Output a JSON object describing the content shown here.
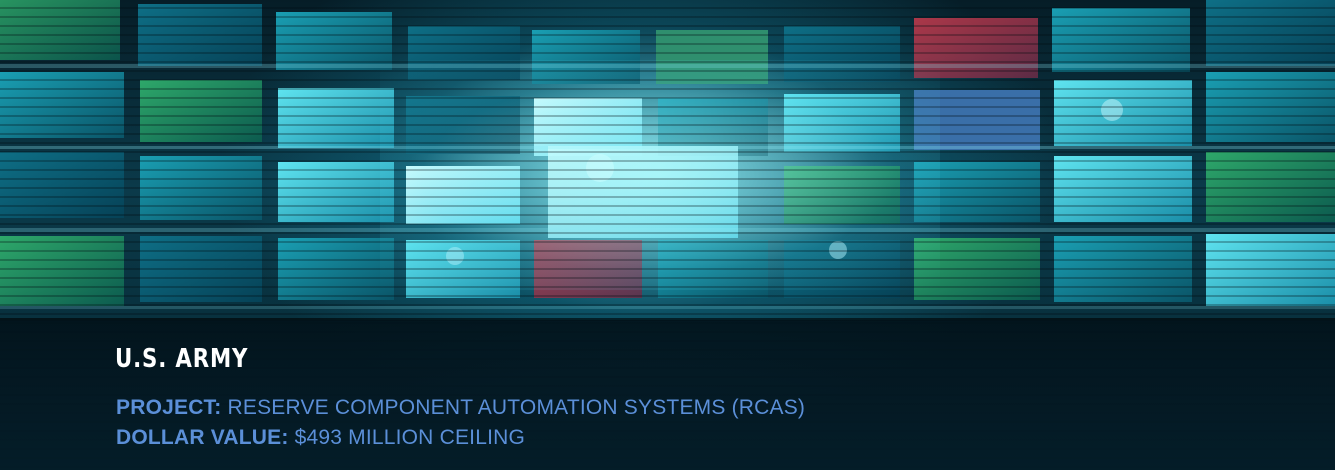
{
  "banner": {
    "agency": "U.S. ARMY",
    "project_label": "PROJECT:",
    "project_value": "RESERVE COMPONENT AUTOMATION SYSTEMS (RCAS)",
    "dollar_label": "DOLLAR VALUE:",
    "dollar_value": "$493 MILLION CEILING"
  },
  "colors": {
    "caption_label": "#5b8fd8",
    "agency_text": "#ffffff",
    "screen_glow": "#7af0ff"
  },
  "image": {
    "subject": "wall of glowing video screens"
  }
}
